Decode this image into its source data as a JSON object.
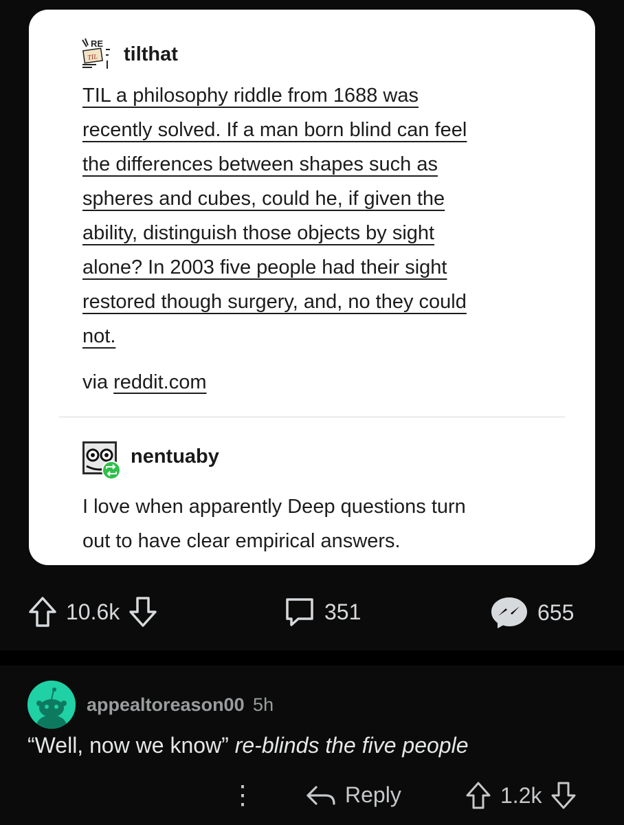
{
  "post": {
    "blog_name": "tilthat",
    "avatar_text": "REI TIL",
    "body": [
      "TIL a philosophy riddle from 1688 was",
      "recently solved. If a man born blind can feel",
      "the differences between shapes such as",
      "spheres and cubes, could he, if given the",
      "ability, distinguish those objects by sight",
      "alone? In 2003 five people had their sight",
      "restored though surgery, and, no they could",
      "not."
    ],
    "via_prefix": "via ",
    "via_link": "reddit.com",
    "reblog_name": "nentuaby",
    "reblog_body": [
      "I love when apparently Deep questions turn",
      "out to have clear empirical answers."
    ]
  },
  "actions": {
    "upvotes": "10.6k",
    "comments": "351",
    "shares": "655"
  },
  "comment": {
    "username": "appealtoreason00",
    "time": "5h",
    "body_plain": "“Well, now we know” ",
    "body_italic": "re-blinds the five people",
    "reply_label": "Reply",
    "votes": "1.2k",
    "more_icon": "⋮"
  },
  "colors": {
    "background": "#0b0b0b",
    "card": "#ffffff",
    "avatar_green": "#1fd1a5",
    "reblog_badge": "#2fbf4a",
    "share_badge": "#d7dadc"
  }
}
